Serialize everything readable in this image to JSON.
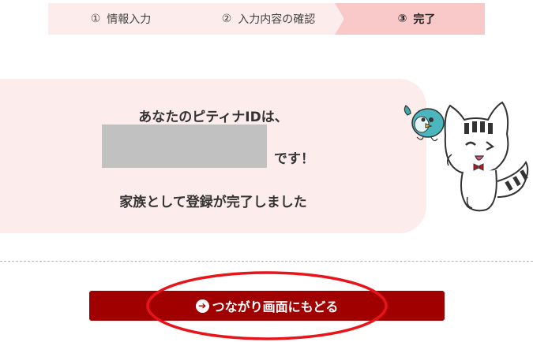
{
  "stepper": {
    "steps": [
      {
        "num": "①",
        "label": "情報入力"
      },
      {
        "num": "②",
        "label": "入力内容の確認"
      },
      {
        "num": "③",
        "label": "完了"
      }
    ]
  },
  "message": {
    "line1": "あなたのピティナIDは、",
    "suffix": "です！",
    "line3": "家族として登録が完了しました"
  },
  "back_button": {
    "label": "つながり画面にもどる",
    "icon": "arrow-right-circle-icon"
  },
  "colors": {
    "step_bg": "#fdecec",
    "step_active_bg": "#f9c8c8",
    "button_bg": "#a00000",
    "annotation_red": "#e8141b"
  }
}
